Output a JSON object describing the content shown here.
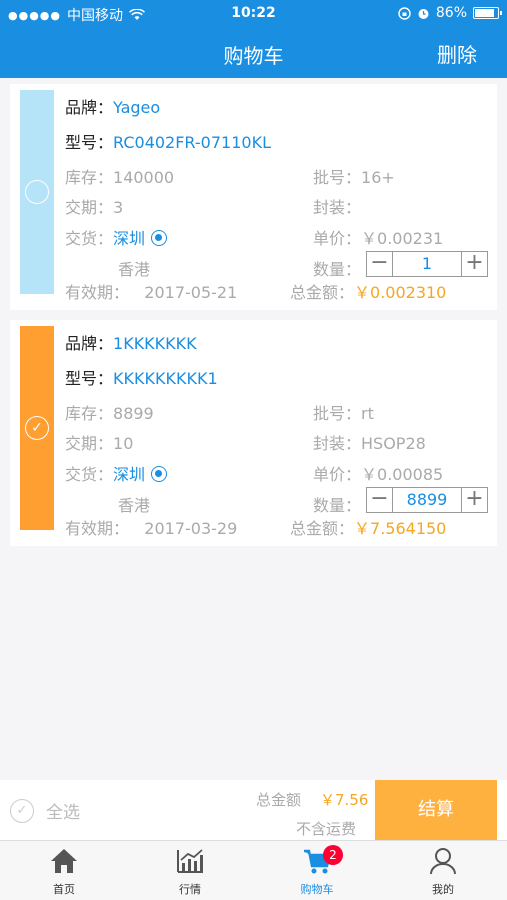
{
  "status": {
    "carrier": "中国移动",
    "time": "10:22",
    "battery": "86%"
  },
  "nav": {
    "title": "购物车",
    "delete_label": "删除"
  },
  "labels": {
    "brand": "品牌：",
    "model": "型号：",
    "stock": "库存：",
    "batch": "批号：",
    "leadtime": "交期：",
    "package": "封装：",
    "delivery": "交货：",
    "unit_price": "单价：",
    "quantity": "数量：",
    "validity": "有效期：",
    "total": "总金额："
  },
  "items": [
    {
      "selected": false,
      "brand": "Yageo",
      "model": "RC0402FR-07110KL",
      "stock": "140000",
      "batch": "16+",
      "leadtime": "3",
      "package": "",
      "delivery_primary": "深圳",
      "delivery_secondary": "香港",
      "unit_price": "￥0.00231",
      "quantity": "1",
      "validity": "2017-05-21",
      "total": "￥0.002310"
    },
    {
      "selected": true,
      "brand": "1KKKKKKK",
      "model": "KKKKKKKKK1",
      "stock": "8899",
      "batch": "rt",
      "leadtime": "10",
      "package": "HSOP28",
      "delivery_primary": "深圳",
      "delivery_secondary": "香港",
      "unit_price": "￥0.00085",
      "quantity": "8899",
      "validity": "2017-03-29",
      "total": "￥7.564150"
    }
  ],
  "checkout": {
    "select_all": "全选",
    "total_label": "总金额",
    "total_value": "￥7.56",
    "shipping_note": "不含运费",
    "pay_label": "结算"
  },
  "tabs": [
    {
      "label": "首页",
      "icon": "home-icon"
    },
    {
      "label": "行情",
      "icon": "chart-icon"
    },
    {
      "label": "购物车",
      "icon": "cart-icon",
      "badge": "2"
    },
    {
      "label": "我的",
      "icon": "user-icon"
    }
  ],
  "colors": {
    "primary": "#1a8ee1",
    "accent": "#f5a623",
    "selected_bar": "#ff9f32",
    "unselected_bar": "#b5e3f7"
  }
}
